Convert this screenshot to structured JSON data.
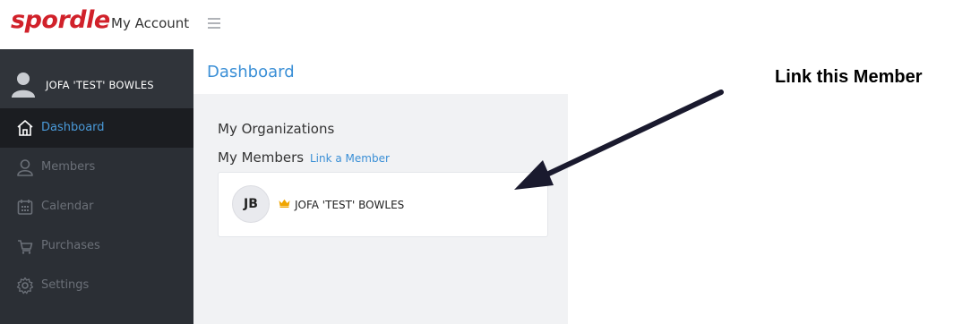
{
  "header": {
    "logo_text": "spordle",
    "app_title": "My Account",
    "menu_icon": "hamburger-icon"
  },
  "sidebar": {
    "user_name": "JOFA 'TEST' BOWLES",
    "items": [
      {
        "label": "Dashboard",
        "icon": "home-icon",
        "active": true
      },
      {
        "label": "Members",
        "icon": "user-icon",
        "active": false
      },
      {
        "label": "Calendar",
        "icon": "calendar-icon",
        "active": false
      },
      {
        "label": "Purchases",
        "icon": "cart-icon",
        "active": false
      },
      {
        "label": "Settings",
        "icon": "gear-icon",
        "active": false
      }
    ]
  },
  "main": {
    "page_title": "Dashboard",
    "organizations_title": "My Organizations",
    "members_title": "My Members",
    "link_member_label": "Link a Member",
    "member": {
      "initials": "JB",
      "name": "JOFA 'TEST' BOWLES",
      "badge_icon": "crown-icon"
    }
  },
  "annotation": {
    "text": "Link this Member"
  },
  "colors": {
    "brand_red": "#d1212a",
    "accent_blue": "#3a8fd6",
    "sidebar_bg": "#2b2f35",
    "crown_gold": "#f0a500"
  }
}
